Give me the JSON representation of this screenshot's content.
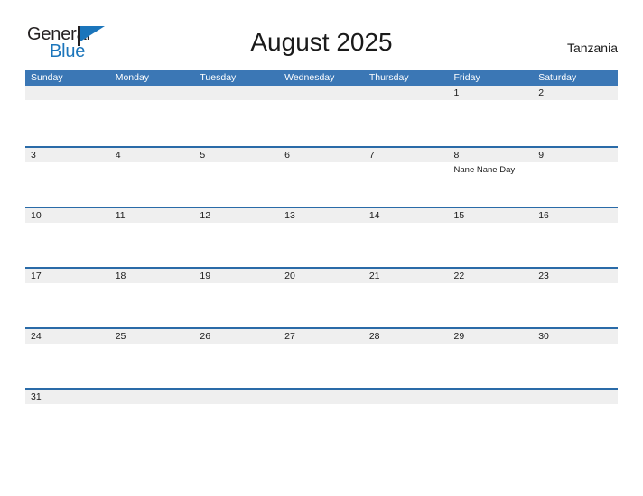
{
  "logo": {
    "word_one": "General",
    "word_two": "Blue",
    "flag_icon": "blue-pennant-flag-icon",
    "colors": {
      "dark": "#231f20",
      "blue": "#1b75bb"
    }
  },
  "header": {
    "title": "August 2025",
    "country": "Tanzania"
  },
  "theme": {
    "header_blue": "#3b77b5",
    "divider_blue": "#2a6ba8",
    "band_gray": "#efefef",
    "text_dark": "#1a1a1a",
    "white": "#ffffff"
  },
  "weekdays": [
    "Sunday",
    "Monday",
    "Tuesday",
    "Wednesday",
    "Thursday",
    "Friday",
    "Saturday"
  ],
  "weeks": [
    {
      "days": [
        {
          "num": "",
          "event": ""
        },
        {
          "num": "",
          "event": ""
        },
        {
          "num": "",
          "event": ""
        },
        {
          "num": "",
          "event": ""
        },
        {
          "num": "",
          "event": ""
        },
        {
          "num": "1",
          "event": ""
        },
        {
          "num": "2",
          "event": ""
        }
      ]
    },
    {
      "days": [
        {
          "num": "3",
          "event": ""
        },
        {
          "num": "4",
          "event": ""
        },
        {
          "num": "5",
          "event": ""
        },
        {
          "num": "6",
          "event": ""
        },
        {
          "num": "7",
          "event": ""
        },
        {
          "num": "8",
          "event": "Nane Nane Day"
        },
        {
          "num": "9",
          "event": ""
        }
      ]
    },
    {
      "days": [
        {
          "num": "10",
          "event": ""
        },
        {
          "num": "11",
          "event": ""
        },
        {
          "num": "12",
          "event": ""
        },
        {
          "num": "13",
          "event": ""
        },
        {
          "num": "14",
          "event": ""
        },
        {
          "num": "15",
          "event": ""
        },
        {
          "num": "16",
          "event": ""
        }
      ]
    },
    {
      "days": [
        {
          "num": "17",
          "event": ""
        },
        {
          "num": "18",
          "event": ""
        },
        {
          "num": "19",
          "event": ""
        },
        {
          "num": "20",
          "event": ""
        },
        {
          "num": "21",
          "event": ""
        },
        {
          "num": "22",
          "event": ""
        },
        {
          "num": "23",
          "event": ""
        }
      ]
    },
    {
      "days": [
        {
          "num": "24",
          "event": ""
        },
        {
          "num": "25",
          "event": ""
        },
        {
          "num": "26",
          "event": ""
        },
        {
          "num": "27",
          "event": ""
        },
        {
          "num": "28",
          "event": ""
        },
        {
          "num": "29",
          "event": ""
        },
        {
          "num": "30",
          "event": ""
        }
      ]
    },
    {
      "days": [
        {
          "num": "31",
          "event": ""
        },
        {
          "num": "",
          "event": ""
        },
        {
          "num": "",
          "event": ""
        },
        {
          "num": "",
          "event": ""
        },
        {
          "num": "",
          "event": ""
        },
        {
          "num": "",
          "event": ""
        },
        {
          "num": "",
          "event": ""
        }
      ]
    }
  ]
}
